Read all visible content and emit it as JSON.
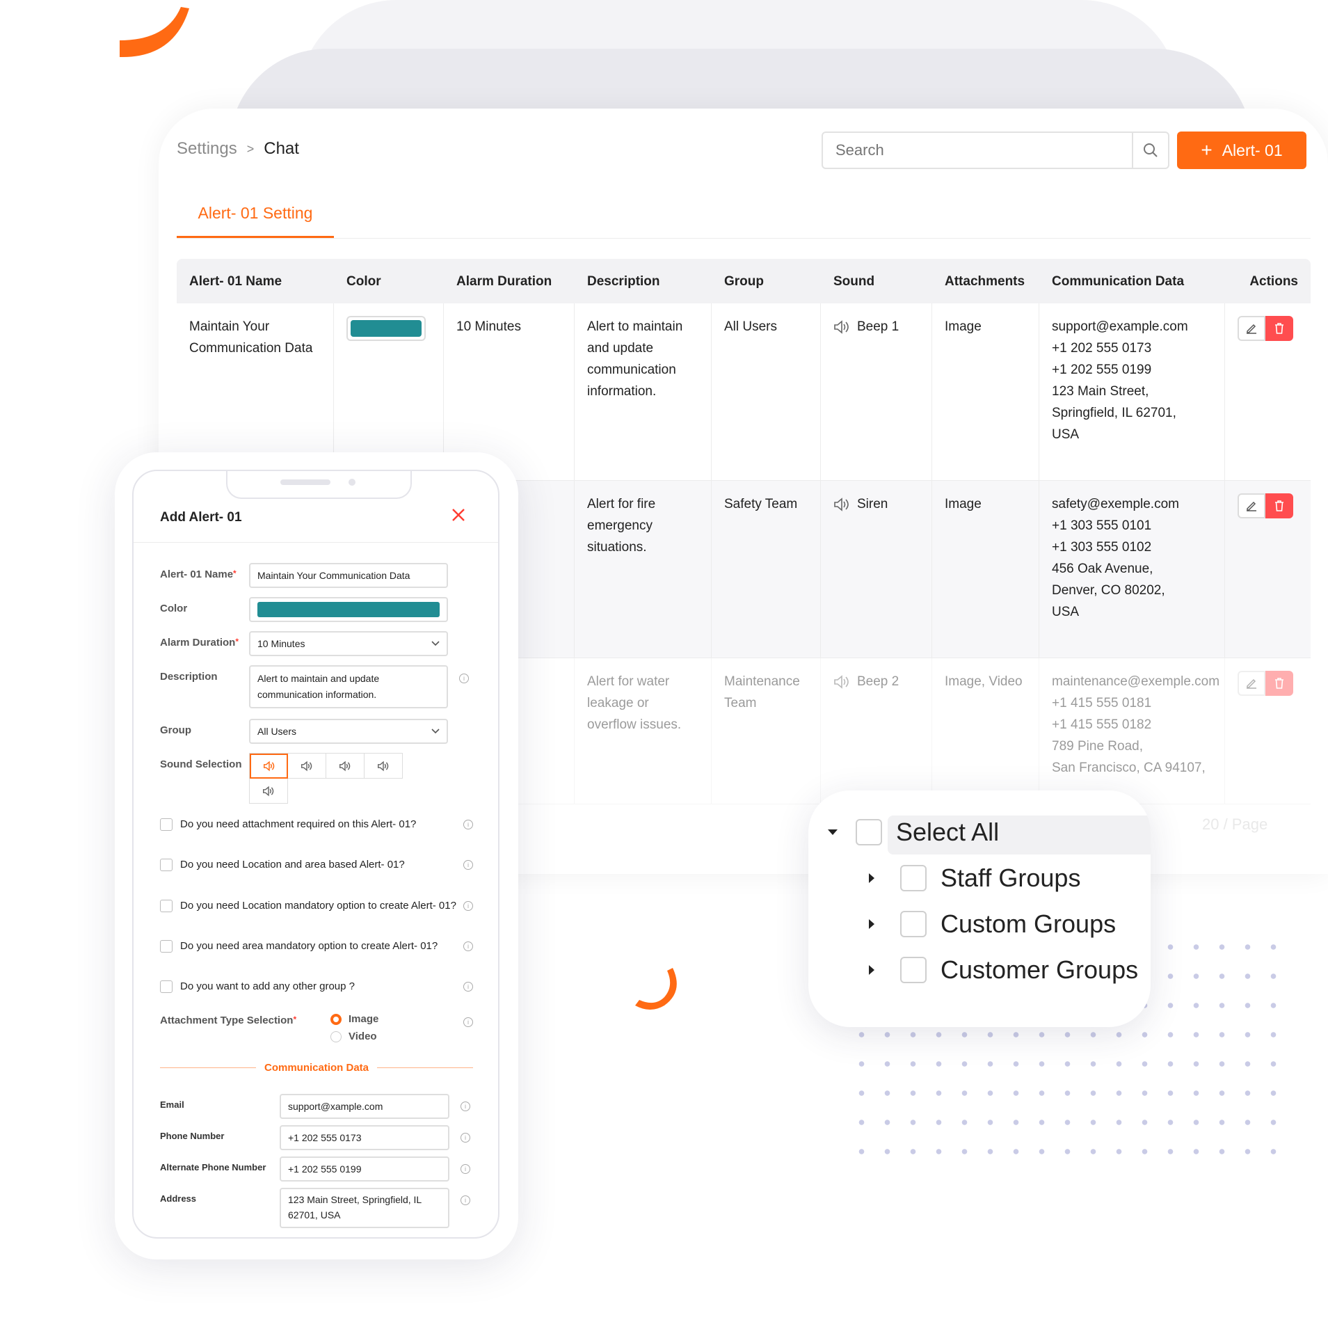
{
  "breadcrumb": {
    "root": "Settings",
    "separator": ">",
    "current": "Chat"
  },
  "search": {
    "placeholder": "Search"
  },
  "add_button": {
    "label": "Alert- 01"
  },
  "tab": {
    "label": "Alert- 01 Setting"
  },
  "table": {
    "headers": [
      "Alert- 01 Name",
      "Color",
      "Alarm Duration",
      "Description",
      "Group",
      "Sound",
      "Attachments",
      "Communication Data",
      "Actions"
    ],
    "rows": [
      {
        "name": "Maintain Your Communication Data",
        "color": "#218d93",
        "duration": "10 Minutes",
        "description": "Alert to maintain and update communication information.",
        "group": "All Users",
        "sound": "Beep 1",
        "attachments": "Image",
        "comm": [
          "support@example.com",
          "+1 202 555 0173",
          "+1 202 555 0199",
          "123 Main Street,",
          "Springfield, IL 62701,",
          "USA"
        ]
      },
      {
        "name": "",
        "color": "",
        "duration": "",
        "description": "Alert for fire emergency situations.",
        "group": "Safety Team",
        "sound": "Siren",
        "attachments": "Image",
        "comm": [
          "safety@exemple.com",
          "+1 303 555 0101",
          "+1 303 555 0102",
          "456 Oak Avenue,",
          "Denver, CO 80202,",
          "USA"
        ]
      },
      {
        "name": "",
        "color": "",
        "duration": "",
        "description": "Alert for water leakage or overflow issues.",
        "group": "Maintenance Team",
        "sound": "Beep 2",
        "attachments": "Image, Video",
        "comm": [
          "maintenance@exemple.com",
          "+1 415 555 0181",
          "+1 415 555 0182",
          "789 Pine Road,",
          "San Francisco, CA 94107,"
        ]
      }
    ]
  },
  "pager": {
    "page_size": "20 / Page"
  },
  "form": {
    "title": "Add Alert- 01",
    "name_label": "Alert- 01 Name",
    "name_value": "Maintain Your Communication Data",
    "color_label": "Color",
    "color_value": "#218d93",
    "duration_label": "Alarm Duration",
    "duration_value": "10 Minutes",
    "description_label": "Description",
    "description_value": "Alert to maintain and update communication information.",
    "group_label": "Group",
    "group_value": "All Users",
    "sound_label": "Sound Selection",
    "questions": [
      "Do you need attachment required on this Alert- 01?",
      "Do you need Location and area based Alert- 01?",
      "Do you need Location mandatory option to create Alert- 01?",
      "Do you need area mandatory option to create Alert- 01?",
      "Do you want to add any other group ?"
    ],
    "attachment_label": "Attachment Type Selection",
    "attachment_options": [
      "Image",
      "Video"
    ],
    "attachment_selected": "Image",
    "comm_heading": "Communication Data",
    "email_label": "Email",
    "email_value": "support@xample.com",
    "phone_label": "Phone Number",
    "phone_value": "+1 202 555 0173",
    "alt_phone_label": "Alternate Phone Number",
    "alt_phone_value": "+1 202 555 0199",
    "address_label": "Address",
    "address_value": "123 Main Street, Springfield, IL 62701, USA"
  },
  "group_tree": {
    "select_all": "Select All",
    "items": [
      "Staff Groups",
      "Custom Groups",
      "Customer Groups"
    ]
  },
  "colors": {
    "accent": "#ff6a13",
    "teal": "#218d93",
    "danger": "#ff4d4f"
  }
}
